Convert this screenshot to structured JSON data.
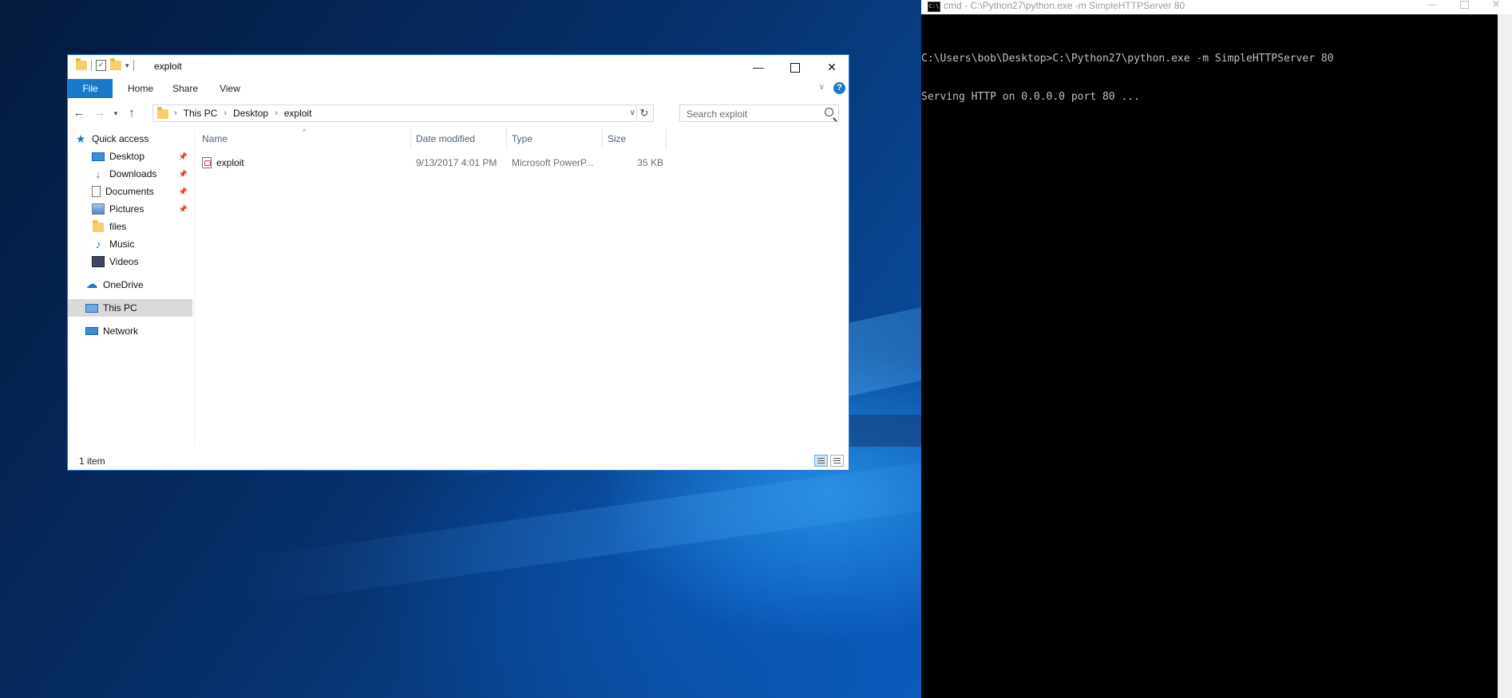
{
  "explorer": {
    "title": "exploit",
    "ribbon_tabs": [
      "File",
      "Home",
      "Share",
      "View"
    ],
    "help_label": "?",
    "address": {
      "crumbs": [
        "This PC",
        "Desktop",
        "exploit"
      ]
    },
    "search": {
      "placeholder": "Search exploit"
    },
    "nav_pane": {
      "items": [
        {
          "label": "Quick access",
          "icon": "star-icon"
        },
        {
          "label": "Desktop",
          "icon": "desktop-icon"
        },
        {
          "label": "Downloads",
          "icon": "download-icon"
        },
        {
          "label": "Documents",
          "icon": "documents-icon"
        },
        {
          "label": "Pictures",
          "icon": "pictures-icon"
        },
        {
          "label": "files",
          "icon": "folder-icon"
        },
        {
          "label": "Music",
          "icon": "music-icon"
        },
        {
          "label": "Videos",
          "icon": "videos-icon"
        },
        {
          "label": "OneDrive",
          "icon": "cloud-icon"
        },
        {
          "label": "This PC",
          "icon": "computer-icon"
        },
        {
          "label": "Network",
          "icon": "network-icon"
        }
      ]
    },
    "columns": {
      "name": "Name",
      "date": "Date modified",
      "type": "Type",
      "size": "Size"
    },
    "files": [
      {
        "name": "exploit",
        "date": "9/13/2017 4:01 PM",
        "type": "Microsoft PowerP...",
        "size": "35 KB"
      }
    ],
    "status": "1 item"
  },
  "console": {
    "title": "cmd - C:\\Python27\\python.exe  -m SimpleHTTPServer 80",
    "lines": [
      "C:\\Users\\bob\\Desktop>C:\\Python27\\python.exe -m SimpleHTTPServer 80",
      "Serving HTTP on 0.0.0.0 port 80 ..."
    ]
  },
  "colors": {
    "accent": "#1979ca",
    "console_bg": "#000000",
    "console_text": "#c0c0c0"
  }
}
